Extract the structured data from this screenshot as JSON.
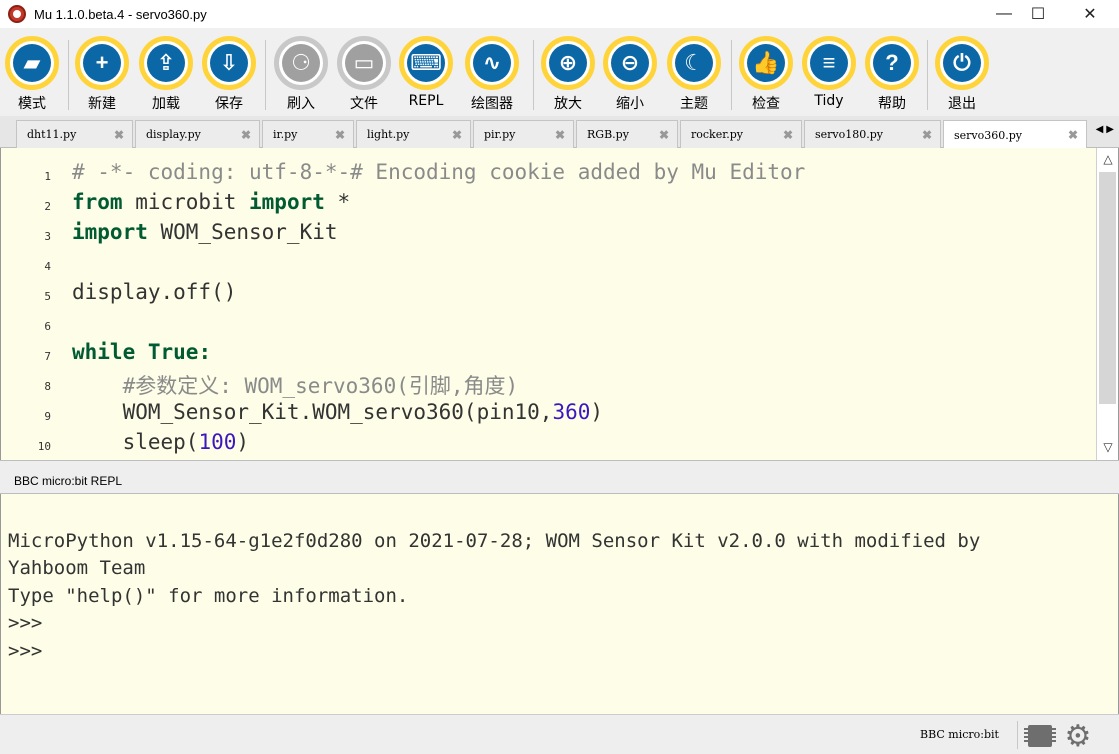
{
  "window": {
    "title": "Mu 1.1.0.beta.4 - servo360.py",
    "controls": {
      "minimize": "—",
      "maximize": "☐",
      "close": "✕"
    }
  },
  "toolbar": {
    "buttons": [
      {
        "id": "mode",
        "label": "模式",
        "glyph": "▰",
        "icon": "mode-icon"
      },
      {
        "id": "new",
        "label": "新建",
        "glyph": "+",
        "icon": "plus-icon"
      },
      {
        "id": "load",
        "label": "加载",
        "glyph": "⇪",
        "icon": "upload-icon"
      },
      {
        "id": "save",
        "label": "保存",
        "glyph": "⇩",
        "icon": "download-icon"
      },
      {
        "id": "flash",
        "label": "刷入",
        "glyph": "⚆",
        "icon": "flash-icon",
        "disabled": true
      },
      {
        "id": "files",
        "label": "文件",
        "glyph": "▭",
        "icon": "files-icon",
        "disabled": true
      },
      {
        "id": "repl",
        "label": "REPL",
        "glyph": "⌨",
        "icon": "keyboard-icon"
      },
      {
        "id": "plotter",
        "label": "绘图器",
        "glyph": "∿",
        "icon": "plotter-icon"
      },
      {
        "id": "zoomin",
        "label": "放大",
        "glyph": "⊕",
        "icon": "zoom-in-icon"
      },
      {
        "id": "zoomout",
        "label": "缩小",
        "glyph": "⊖",
        "icon": "zoom-out-icon"
      },
      {
        "id": "theme",
        "label": "主题",
        "glyph": "☾",
        "icon": "moon-icon"
      },
      {
        "id": "check",
        "label": "检查",
        "glyph": "👍",
        "icon": "thumbs-up-icon"
      },
      {
        "id": "tidy",
        "label": "Tidy",
        "glyph": "≡",
        "icon": "tidy-icon"
      },
      {
        "id": "help",
        "label": "帮助",
        "glyph": "?",
        "icon": "help-icon"
      },
      {
        "id": "quit",
        "label": "退出",
        "glyph": "⏻",
        "icon": "power-icon"
      }
    ]
  },
  "tabs": {
    "items": [
      {
        "label": "dht11.py"
      },
      {
        "label": "display.py"
      },
      {
        "label": "ir.py"
      },
      {
        "label": "light.py"
      },
      {
        "label": "pir.py"
      },
      {
        "label": "RGB.py"
      },
      {
        "label": "rocker.py"
      },
      {
        "label": "servo180.py"
      },
      {
        "label": "servo360.py",
        "active": true
      }
    ],
    "close_glyph": "✖",
    "arrows": "◀▶"
  },
  "editor": {
    "lines": [
      {
        "n": "1",
        "parts": [
          {
            "t": "# -*- coding: utf-8-*-# Encoding cookie added by Mu Editor",
            "c": "cm"
          }
        ]
      },
      {
        "n": "2",
        "parts": [
          {
            "t": "from",
            "c": "kw"
          },
          {
            "t": " microbit ",
            "c": ""
          },
          {
            "t": "import",
            "c": "kw"
          },
          {
            "t": " *",
            "c": ""
          }
        ]
      },
      {
        "n": "3",
        "parts": [
          {
            "t": "import",
            "c": "kw"
          },
          {
            "t": " WOM_Sensor_Kit",
            "c": ""
          }
        ]
      },
      {
        "n": "4",
        "parts": []
      },
      {
        "n": "5",
        "parts": [
          {
            "t": "display.off()",
            "c": ""
          }
        ]
      },
      {
        "n": "6",
        "parts": []
      },
      {
        "n": "7",
        "parts": [
          {
            "t": "while",
            "c": "kw"
          },
          {
            "t": " ",
            "c": ""
          },
          {
            "t": "True",
            "c": "kw"
          },
          {
            "t": ":",
            "c": "kw"
          }
        ]
      },
      {
        "n": "8",
        "parts": [
          {
            "t": "    #参数定义: WOM_servo360(引脚,角度)",
            "c": "cm"
          }
        ]
      },
      {
        "n": "9",
        "parts": [
          {
            "t": "    WOM_Sensor_Kit.WOM_servo360(pin10,",
            "c": ""
          },
          {
            "t": "360",
            "c": "num"
          },
          {
            "t": ")",
            "c": ""
          }
        ]
      },
      {
        "n": "10",
        "parts": [
          {
            "t": "    sleep(",
            "c": ""
          },
          {
            "t": "100",
            "c": "num"
          },
          {
            "t": ")",
            "c": ""
          }
        ]
      }
    ],
    "scroll_up": "△",
    "scroll_down": "▽"
  },
  "repl": {
    "title": "BBC micro:bit REPL",
    "lines": [
      "",
      "MicroPython v1.15-64-g1e2f0d280 on 2021-07-28; WOM Sensor Kit v2.0.0 with modified by",
      "Yahboom Team",
      "Type \"help()\" for more information.",
      ">>>",
      ">>>"
    ]
  },
  "statusbar": {
    "mode": "BBC micro:bit",
    "gear": "⚙"
  },
  "colors": {
    "accent": "#ffd43b",
    "icon_fill": "#0b67a5",
    "disabled": "#a0a0a0",
    "editor_bg": "#fefee8",
    "keyword": "#005a32",
    "comment": "#8a8a8a",
    "number": "#3b17c0"
  }
}
